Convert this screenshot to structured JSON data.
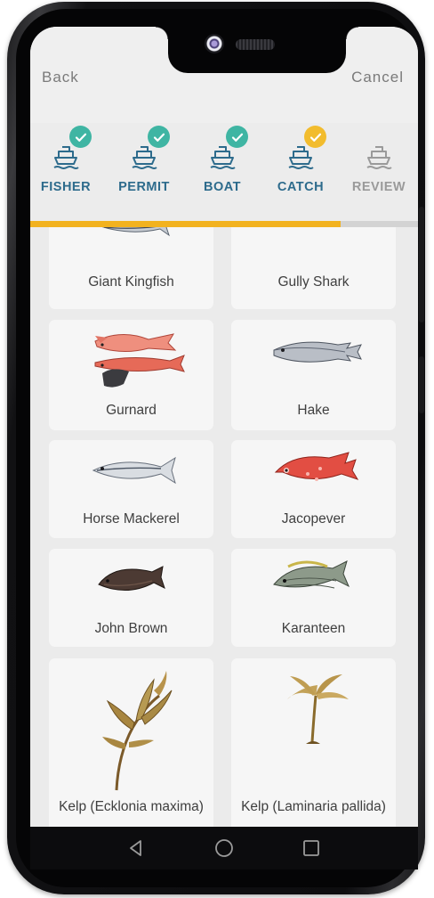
{
  "header": {
    "back_label": "Back",
    "cancel_label": "Cancel"
  },
  "steps": [
    {
      "label": "FISHER",
      "completed": true
    },
    {
      "label": "PERMIT",
      "completed": true
    },
    {
      "label": "BOAT",
      "completed": true
    },
    {
      "label": "CATCH",
      "completed": true,
      "current": true
    },
    {
      "label": "REVIEW",
      "completed": false
    }
  ],
  "progress": {
    "percent": 80
  },
  "colors": {
    "brand_blue": "#2d6b8c",
    "check_teal": "#3fb5a3",
    "check_yellow": "#f2bc2e",
    "progress_yellow": "#f2b21f",
    "inactive_gray": "#9a9a9a"
  },
  "fish": [
    {
      "name": "Giant Kingfish",
      "icon": "giant-kingfish-image"
    },
    {
      "name": "Gully Shark",
      "icon": "gully-shark-image"
    },
    {
      "name": "Gurnard",
      "icon": "gurnard-image"
    },
    {
      "name": "Hake",
      "icon": "hake-image"
    },
    {
      "name": "Horse Mackerel",
      "icon": "horse-mackerel-image"
    },
    {
      "name": "Jacopever",
      "icon": "jacopever-image"
    },
    {
      "name": "John Brown",
      "icon": "john-brown-image"
    },
    {
      "name": "Karanteen",
      "icon": "karanteen-image"
    },
    {
      "name": "Kelp (Ecklonia maxima)",
      "icon": "kelp-ecklonia-image"
    },
    {
      "name": "Kelp (Laminaria pallida)",
      "icon": "kelp-laminaria-image"
    }
  ],
  "nav": {
    "back_icon": "triangle-back-icon",
    "home_icon": "circle-home-icon",
    "recent_icon": "square-recents-icon"
  }
}
